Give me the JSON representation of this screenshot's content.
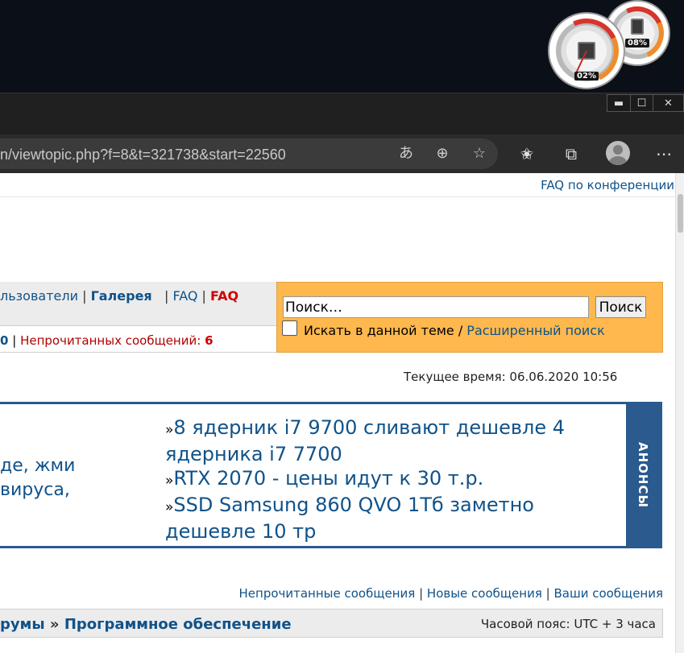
{
  "gadgets": {
    "gauge_cpu_value": "02%",
    "gauge_ram_value": "08%"
  },
  "window": {
    "minimize": "▬",
    "maximize": "☐",
    "close": "✕"
  },
  "browser": {
    "url": "n/viewtopic.php?f=8&t=321738&start=22560"
  },
  "page": {
    "faq_top": "FAQ по конференции",
    "nav": {
      "users": "льзователи",
      "sep1": "|",
      "gallery": "Галерея",
      "sep2": "|",
      "faq": "FAQ",
      "sep3": "|",
      "faq_red": "FAQ"
    },
    "unread": {
      "count_prev": "0",
      "sep": "|",
      "label": "Непрочитанных сообщений:",
      "count": "6"
    },
    "search": {
      "value": "Поиск…",
      "button": "Поиск",
      "checkbox_label": "Искать в данной теме /",
      "advanced": "Расширенный поиск"
    },
    "current_time": "Текущее время: 06.06.2020 10:56",
    "announce": {
      "left_line1": "де, жми",
      "left_line2": "вируса,",
      "items": [
        "8 ядерник i7 9700 сливают дешевле 4 ядерника i7 7700",
        "RTX 2070 - цены идут к 30 т.р.",
        "SSD Samsung 860 QVO 1Тб заметно дешевле 10 тр"
      ],
      "bullet": "»",
      "side_label": "АНОНСЫ"
    },
    "message_links": {
      "unread": "Непрочитанные сообщения",
      "new": "Новые сообщения",
      "yours": "Ваши сообщения",
      "sep": "|"
    },
    "breadcrumb": {
      "forums": "румы",
      "sep": "»",
      "section": "Программное обеспечение"
    },
    "timezone": "Часовой пояс: UTC + 3 часа"
  }
}
